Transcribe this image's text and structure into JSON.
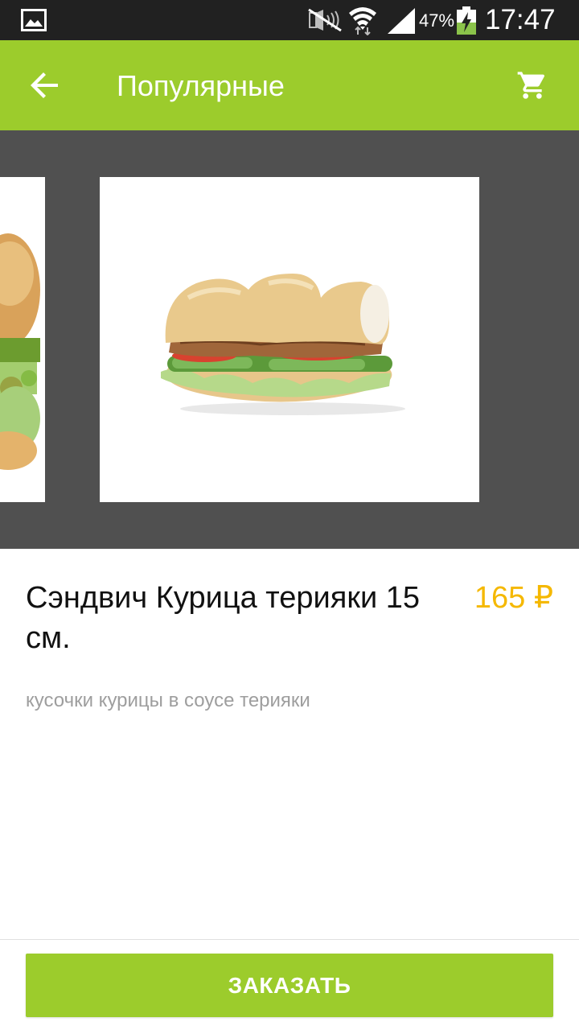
{
  "status_bar": {
    "battery_percent": "47%",
    "time": "17:47",
    "icons": [
      "gallery-icon",
      "mute-icon",
      "wifi-icon",
      "signal-icon",
      "battery-charging-icon"
    ]
  },
  "app_bar": {
    "title": "Популярные",
    "back_icon": "arrow-back-icon",
    "cart_icon": "shopping-cart-icon"
  },
  "product": {
    "name": "Сэндвич Курица терияки 15 см.",
    "price": "165 ₽",
    "description": "кусочки курицы в соусе терияки"
  },
  "actions": {
    "order_label": "ЗАКАЗАТЬ"
  },
  "colors": {
    "accent": "#9ccc2c",
    "price": "#f5b800",
    "status_bar": "#212121",
    "carousel_bg": "#505050"
  }
}
